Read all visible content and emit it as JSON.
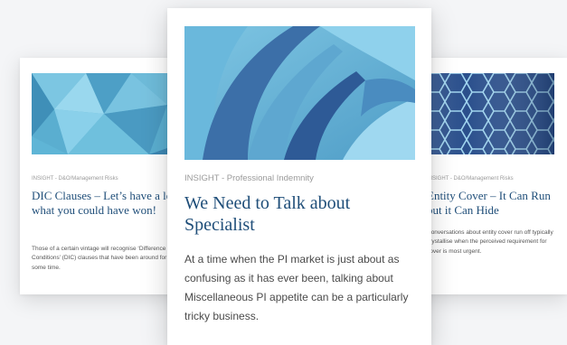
{
  "cards": [
    {
      "category": "INSIGHT - D&O/Management Risks",
      "title": "DIC Clauses – Let’s have a look at what you could have won!",
      "excerpt": "Those of a certain vintage will recognise ‘Difference in Conditions’ (DIC) clauses that have been around for quite some time.",
      "image_icon": "geometric-polygon-pattern"
    },
    {
      "category": "INSIGHT - Professional Indemnity",
      "title": "We Need to Talk about Specialist",
      "excerpt": "At a time when the PI market is just about as confusing as it has ever been, talking about Miscellaneous PI appetite can be a particularly tricky business.",
      "image_icon": "abstract-curved-planes"
    },
    {
      "category": "INSIGHT - D&O/Management Risks",
      "title": "Entity Cover – It Can Run but it Can Hide",
      "excerpt": "Conversations about entity cover run off typically crystallise when the perceived requirement for cover is most urgent.",
      "image_icon": "hexagon-grid-pattern"
    }
  ],
  "colors": {
    "title": "#1f4e79",
    "category": "#9a9a9a",
    "excerpt": "#555555",
    "background": "#f4f5f7",
    "image_teal": "#5fb3cf",
    "image_navy": "#23427a"
  }
}
